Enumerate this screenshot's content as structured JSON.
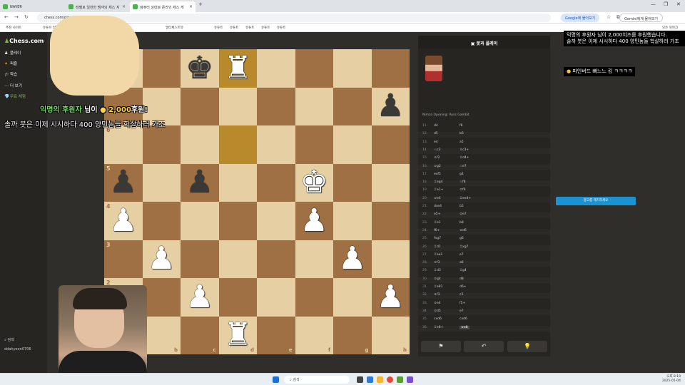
{
  "browser": {
    "tabs": [
      {
        "label": "NAVER"
      },
      {
        "label": "레벨로 일반한 뱀객의 체스 지"
      },
      {
        "label": "컴퓨터 상대로 온라인 체스 게"
      }
    ],
    "address": "chess.com/play/computer",
    "lens_chip": "Google에 물어보기",
    "gemini_chip": "Gemini에게 물어보기",
    "bookmarks": [
      "추천 사이트",
      "유튜브 일반",
      "멀티체스트뷰",
      "유튜트",
      "유튜트",
      "유튜트",
      "유튜트",
      "유튜트",
      "모든 북마크"
    ]
  },
  "sidebar": {
    "logo": "Chess.com",
    "items": [
      {
        "icon": "♟",
        "label": "플레이"
      },
      {
        "icon": "✦",
        "label": "퍼즐"
      },
      {
        "icon": "🎓",
        "label": "학습"
      },
      {
        "icon": "⋯",
        "label": "더 보기"
      },
      {
        "icon": "💎",
        "label": "무료 체험"
      }
    ],
    "search": "검색",
    "username": "ddahyeon0706"
  },
  "board": {
    "ranks": [
      "8",
      "7",
      "6",
      "5",
      "4",
      "3",
      "2",
      "1"
    ],
    "files": [
      "a",
      "b",
      "c",
      "d",
      "e",
      "f",
      "g",
      "h"
    ],
    "rows": [
      [
        "",
        "",
        "k",
        "R",
        "",
        "",
        "",
        ""
      ],
      [
        "",
        "",
        "",
        "",
        "",
        "",
        "",
        "p"
      ],
      [
        "",
        "",
        "",
        "",
        "",
        "",
        "",
        ""
      ],
      [
        "p",
        "",
        "p",
        "",
        "",
        "K",
        "",
        ""
      ],
      [
        "P",
        "",
        "",
        "",
        "",
        "P",
        "",
        ""
      ],
      [
        "",
        "P",
        "",
        "",
        "",
        "",
        "P",
        ""
      ],
      [
        "",
        "",
        "P",
        "",
        "",
        "",
        "",
        "P"
      ],
      [
        "",
        "",
        "",
        "R",
        "",
        "",
        "",
        ""
      ]
    ],
    "highlights": [
      "d8",
      "d6"
    ]
  },
  "right_panel": {
    "title": "봇과 플레이",
    "opening": "Nimzo Opening: Ross Gambit",
    "moves": [
      {
        "n": "11.",
        "w": "d4",
        "b": "f6"
      },
      {
        "n": "12.",
        "w": "d5",
        "b": "b6"
      },
      {
        "n": "13.",
        "w": "e4",
        "b": "a5"
      },
      {
        "n": "14.",
        "w": "♘c3",
        "b": "♗c3+"
      },
      {
        "n": "15.",
        "w": "♔f2",
        "b": "♗d4+"
      },
      {
        "n": "16.",
        "w": "♔g2",
        "b": "♘e7"
      },
      {
        "n": "17.",
        "w": "exf5",
        "b": "g4"
      },
      {
        "n": "18.",
        "w": "♖eg4",
        "b": "♘f8"
      },
      {
        "n": "19.",
        "w": "♖e1+",
        "b": "♔f6"
      },
      {
        "n": "20.",
        "w": "♔e4",
        "b": "♖ee4+"
      },
      {
        "n": "21.",
        "w": "dxe4",
        "b": "b5"
      },
      {
        "n": "22.",
        "w": "e5+",
        "b": "♔e7"
      },
      {
        "n": "23.",
        "w": "♖e1",
        "b": "b8"
      },
      {
        "n": "24.",
        "w": "f6+",
        "b": "♔d6"
      },
      {
        "n": "25.",
        "w": "fxg7",
        "b": "g6"
      },
      {
        "n": "26.",
        "w": "♖d1",
        "b": "♖xg7"
      },
      {
        "n": "27.",
        "w": "♖ae1",
        "b": "e7"
      },
      {
        "n": "28.",
        "w": "♔f3",
        "b": "a6"
      },
      {
        "n": "29.",
        "w": "♖d3",
        "b": "♖g4"
      },
      {
        "n": "30.",
        "w": "♔g4",
        "b": "d8"
      },
      {
        "n": "31.",
        "w": "♖e81",
        "b": "d6+"
      },
      {
        "n": "32.",
        "w": "♔f3",
        "b": "c5"
      },
      {
        "n": "33.",
        "w": "♔e4",
        "b": "f5+"
      },
      {
        "n": "34.",
        "w": "♔d5",
        "b": "e7"
      },
      {
        "n": "35.",
        "w": "cxd6",
        "b": "cxd6"
      },
      {
        "n": "36.",
        "w": "♖e8+",
        "b": "♔e8"
      }
    ],
    "controls": [
      "⚑",
      "↶",
      "💡"
    ]
  },
  "ad_remove_button": "광고를 제거하세요",
  "overlays": {
    "chat_top": "익명의 후원자 님이 2,000치즈를 후원했습니다.\n솔까 붓은 이제 시시하다 400 양민놈들 학살하러 가조",
    "chat_small": "파인버드 빠느느 킹 ㅋㅋㅋㅋ",
    "donation_name": "익명의 후원자",
    "donation_suffix": "님이",
    "donation_amount": "2,000",
    "donation_unit": "후원!",
    "donation_message": "솔까 붓은 이제 시시하다 400 양민놈들 학살하러 가조"
  },
  "taskbar": {
    "search": "검색",
    "time": "오후 8:19",
    "date": "2025-05-04"
  }
}
